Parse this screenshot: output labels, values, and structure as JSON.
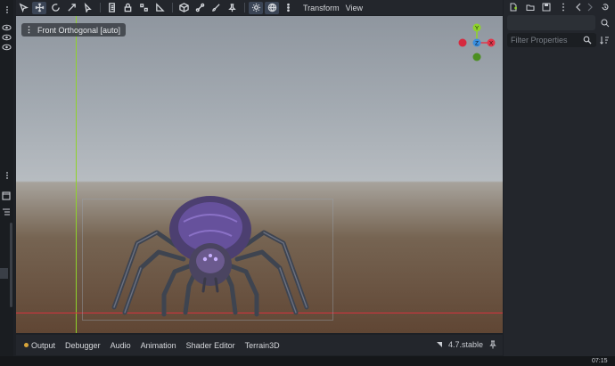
{
  "toolbar": {
    "menus": [
      "Transform",
      "View"
    ]
  },
  "viewport": {
    "label": "Front Orthogonal [auto]",
    "gizmo": {
      "y": "Y",
      "z": "Z",
      "x": "X"
    }
  },
  "inspector": {
    "filter_placeholder": "Filter Properties"
  },
  "bottom_panel": {
    "tabs": [
      "Output",
      "Debugger",
      "Audio",
      "Animation",
      "Shader Editor",
      "Terrain3D"
    ],
    "version": "4.7.stable"
  },
  "status": {
    "time": "07:15"
  },
  "colors": {
    "axis_x": "#e2364a",
    "axis_y": "#8fd32a",
    "axis_z": "#3a8fe0",
    "active_tool": "#3b4556"
  }
}
